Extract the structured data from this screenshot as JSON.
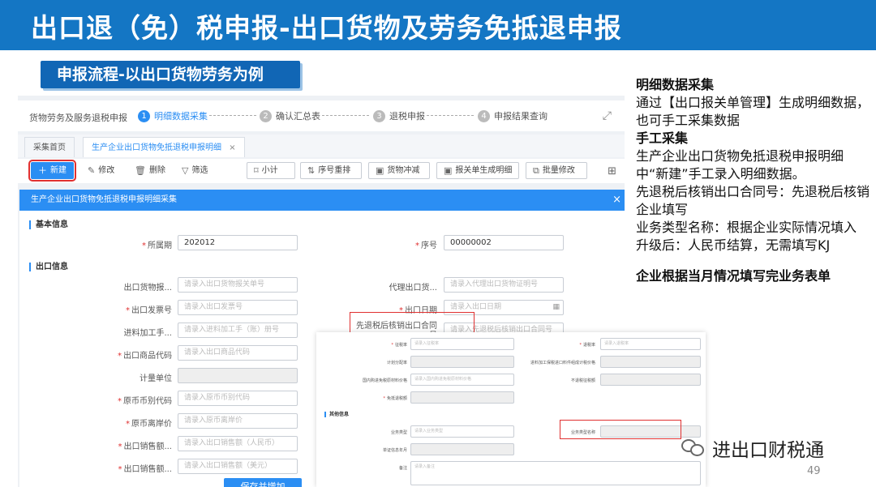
{
  "slide": {
    "title": "出口退（免）税申报-出口货物及劳务免抵退申报",
    "subtitle": "申报流程-以出口货物劳务为例",
    "page_number": "49",
    "watermark": "进出口财税通"
  },
  "notes": {
    "h1": "明细数据采集",
    "p1": "通过【出口报关单管理】生成明细数据，也可手工采集数据",
    "h2": "手工采集",
    "p2": "生产企业出口货物免抵退税申报明细中“新建”手工录入明细数据。",
    "p3": "先退税后核销出口合同号：先退税后核销企业填写",
    "p4": "业务类型名称：根据企业实际情况填入",
    "p5": "升级后：人民币结算，无需填写KJ",
    "p6": "企业根据当月情况填写完业务表单"
  },
  "steps": {
    "crumb": "货物劳务及服务退税申报",
    "items": [
      {
        "num": "1",
        "label": "明细数据采集"
      },
      {
        "num": "2",
        "label": "确认汇总表"
      },
      {
        "num": "3",
        "label": "退税申报"
      },
      {
        "num": "4",
        "label": "申报结果查询"
      }
    ]
  },
  "tabs": {
    "home": "采集首页",
    "detail": "生产企业出口货物免抵退税申报明细",
    "close": "×"
  },
  "toolbar": {
    "new": "新建",
    "edit": "修改",
    "delete": "删除",
    "filter": "筛选",
    "subtotal": "小计",
    "resort": "序号重排",
    "goods_reduce": "货物冲减",
    "gen_from_customs": "报关单生成明细",
    "batch_edit": "批量修改"
  },
  "dialog": {
    "title": "生产企业出口货物免抵退税申报明细采集",
    "close": "×",
    "section_basic": "基本信息",
    "section_export": "出口信息",
    "period_label": "所属期",
    "period_value": "202012",
    "seq_label": "序号",
    "seq_value": "00000002",
    "customs_label": "出口货物报...",
    "customs_placeholder": "请录入出口货物报关单号",
    "agent_label": "代理出口货...",
    "agent_placeholder": "请录入代理出口货物证明号",
    "invoice_label": "出口发票号",
    "invoice_placeholder": "请录入出口发票号",
    "export_date_label": "出口日期",
    "export_date_placeholder": "请录入出口日期",
    "processing_label": "进料加工手...",
    "processing_placeholder": "请录入进料加工手（账）册号",
    "contract_label": "先退税后核销出口合同号",
    "contract_placeholder": "请录入先退税后核销出口合同号",
    "product_code_label": "出口商品代码",
    "product_code_placeholder": "请录入出口商品代码",
    "unit_label": "计量单位",
    "currency_label": "原币币别代码",
    "currency_placeholder": "请录入原币币别代码",
    "orig_price_label": "原币离岸价",
    "orig_price_placeholder": "请录入原币离岸价",
    "sales_rmb_label": "出口销售额...",
    "sales_rmb_placeholder": "请录入出口销售额（人民币）",
    "sales_usd_label": "出口销售额...",
    "sales_usd_placeholder": "请录入出口销售额（美元）",
    "save": "保存并增加"
  },
  "overlay": {
    "f1_label": "征税率",
    "f1_placeholder": "请录入征税率",
    "f2_label": "退税率",
    "f2_placeholder": "请录入退税率",
    "f3_label": "计划分配率",
    "f4_label": "进料加工保税进口料件组成计税价格",
    "f5_label": "国内购进免税原材料价格",
    "f5_placeholder": "请录入国内购进免税原材料价格",
    "f6_label": "不退税征税额",
    "f7_label": "免抵退税额",
    "section": "其他信息",
    "f8_label": "业务类型",
    "f8_placeholder": "请录入业务类型",
    "f9_label": "业务类型名称",
    "f10_label": "单证信息年月",
    "f11_label": "备注",
    "f11_placeholder": "请录入备注"
  }
}
